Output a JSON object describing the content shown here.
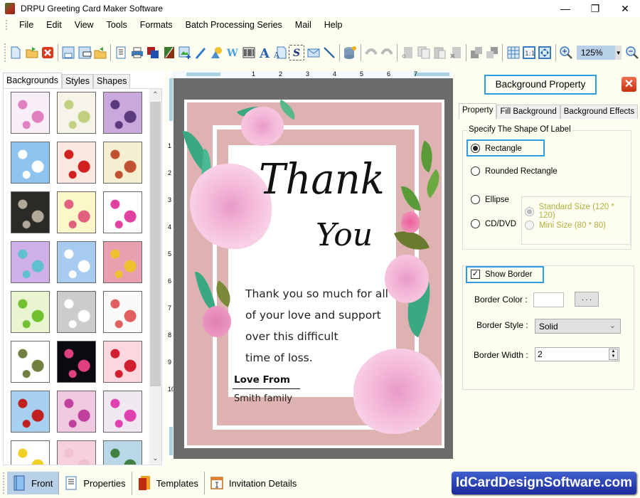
{
  "window": {
    "title": "DRPU Greeting Card Maker Software",
    "controls": {
      "minimize": "—",
      "restore": "❐",
      "close": "✕"
    }
  },
  "menu": [
    "File",
    "Edit",
    "View",
    "Tools",
    "Formats",
    "Batch Processing Series",
    "Mail",
    "Help"
  ],
  "toolbar": {
    "zoom_value": "125%",
    "icons": [
      "new-icon",
      "open-icon",
      "close-doc-icon",
      "save-icon",
      "save-as-icon",
      "export-icon",
      "page-setup-icon",
      "print-icon",
      "layers-icon",
      "background-icon",
      "add-image-icon",
      "pen-icon",
      "shapes-icon",
      "watermark-icon",
      "barcode-icon",
      "text-icon",
      "word-art-icon",
      "signature-icon",
      "email-icon",
      "line-icon",
      "database-icon",
      "undo-icon",
      "redo-icon",
      "cut-icon",
      "copy-icon",
      "paste-icon",
      "delete-icon",
      "bring-front-icon",
      "send-back-icon",
      "grid-icon",
      "actual-size-icon",
      "fit-window-icon",
      "zoom-in-icon",
      "zoom-out-icon"
    ]
  },
  "left_panel": {
    "tabs": [
      "Backgrounds",
      "Styles",
      "Shapes"
    ],
    "active_tab": "Backgrounds",
    "thumbnails": [
      {
        "name": "baby-pastel",
        "bg": "#f7eef7",
        "accent": "#e080c0"
      },
      {
        "name": "baby-letters",
        "bg": "#f6f3e8",
        "accent": "#c0d080"
      },
      {
        "name": "purple-floral",
        "bg": "#c9a8dd",
        "accent": "#5a3a7a"
      },
      {
        "name": "clouds",
        "bg": "#8ec4ee",
        "accent": "#ffffff"
      },
      {
        "name": "strawberries",
        "bg": "#fbe8e0",
        "accent": "#d02020"
      },
      {
        "name": "leaves-fruit",
        "bg": "#f5eed0",
        "accent": "#c05030"
      },
      {
        "name": "dark-bubbles",
        "bg": "#2a2a26",
        "accent": "#b0a898"
      },
      {
        "name": "flowers-row",
        "bg": "#fbf7c8",
        "accent": "#e06080"
      },
      {
        "name": "gift-boxes",
        "bg": "#ffffff",
        "accent": "#e040a0"
      },
      {
        "name": "pastel-circles",
        "bg": "#d0b0e8",
        "accent": "#60c0d0"
      },
      {
        "name": "snowflakes",
        "bg": "#a8cbf0",
        "accent": "#ffffff"
      },
      {
        "name": "colorful-circles",
        "bg": "#e8a0b0",
        "accent": "#f0c030"
      },
      {
        "name": "green-trees",
        "bg": "#e8f5d0",
        "accent": "#70c030"
      },
      {
        "name": "white-heart",
        "bg": "#cccccc",
        "accent": "#ffffff"
      },
      {
        "name": "kids-doodles",
        "bg": "#fafafa",
        "accent": "#e06060"
      },
      {
        "name": "tea-bags",
        "bg": "#ffffff",
        "accent": "#708040"
      },
      {
        "name": "fireworks",
        "bg": "#0a0a10",
        "accent": "#e04080"
      },
      {
        "name": "red-hearts",
        "bg": "#fbd8e0",
        "accent": "#d02030"
      },
      {
        "name": "santa",
        "bg": "#a8d0f0",
        "accent": "#c02020"
      },
      {
        "name": "pink-dots",
        "bg": "#f0c8e0",
        "accent": "#c040a0"
      },
      {
        "name": "butterflies",
        "bg": "#f0e8f0",
        "accent": "#e040b0"
      },
      {
        "name": "stars",
        "bg": "#ffffff",
        "accent": "#f0d020"
      },
      {
        "name": "pink-plain",
        "bg": "#f6d0dc",
        "accent": "#f0c0d0"
      },
      {
        "name": "snowmen",
        "bg": "#b8d8e8",
        "accent": "#408040"
      }
    ]
  },
  "canvas": {
    "ruler_h": [
      "1",
      "2",
      "3",
      "4",
      "5",
      "6",
      "7"
    ],
    "ruler_v": [
      "1",
      "2",
      "3",
      "4",
      "5",
      "6",
      "7",
      "8",
      "9",
      "10"
    ],
    "card": {
      "title_line1": "Thank",
      "title_line2": "You",
      "message_lines": [
        "Thank you so much for all",
        "of your love and support",
        "over this difficult",
        "time of loss."
      ],
      "signoff": "Love From",
      "signature": "Smith family",
      "colors": {
        "frame": "#dfb2b2",
        "flower": "#f4b8d8",
        "leaf": "#3aa880"
      }
    }
  },
  "right_panel": {
    "header": "Background Property",
    "close_label": "✕",
    "tabs": [
      "Property",
      "Fill Background",
      "Background Effects"
    ],
    "active_tab": "Property",
    "shape_group": {
      "label": "Specify The Shape Of Label",
      "options": [
        {
          "label": "Rectangle",
          "checked": true
        },
        {
          "label": "Rounded Rectangle",
          "checked": false
        },
        {
          "label": "Ellipse",
          "checked": false
        },
        {
          "label": "CD/DVD",
          "checked": false
        }
      ],
      "cd_sizes": [
        {
          "label": "Standard Size (120 * 120)",
          "checked": true,
          "disabled": true
        },
        {
          "label": "Mini Size (80 * 80)",
          "checked": false,
          "disabled": true
        }
      ]
    },
    "border_group": {
      "show_border_label": "Show Border",
      "show_border_checked": true,
      "border_color_label": "Border Color :",
      "border_color_value": "#ffffff",
      "color_picker_label": ". . .",
      "border_style_label": "Border Style :",
      "border_style_value": "Solid",
      "border_width_label": "Border Width :",
      "border_width_value": "2"
    }
  },
  "bottom_bar": {
    "buttons": [
      {
        "label": "Front",
        "active": true
      },
      {
        "label": "Properties",
        "active": false
      },
      {
        "label": "Templates",
        "active": false
      },
      {
        "label": "Invitation Details",
        "active": false
      }
    ],
    "brand": "IdCardDesignSoftware.com"
  }
}
